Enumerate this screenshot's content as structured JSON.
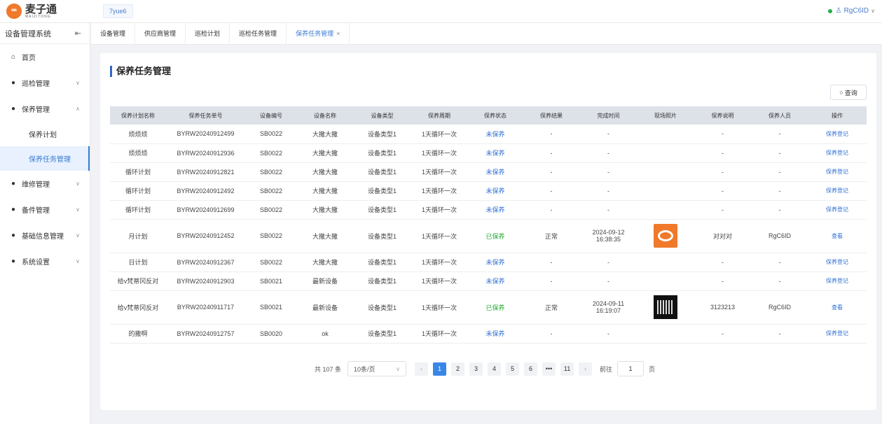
{
  "header": {
    "logo_mark": "ꟹ",
    "logo_cn": "麦子通",
    "logo_en": "MAIZITONG",
    "project": "7yue6",
    "user_name": "RgC6ID",
    "online_color": "#22b14c"
  },
  "sidebar": {
    "system_title": "设备管理系统",
    "collapse_icon": "collapse-left-icon",
    "items": [
      {
        "label": "首页",
        "icon": "home-icon"
      },
      {
        "label": "巡检管理",
        "icon": "person-icon"
      },
      {
        "label": "保养管理",
        "icon": "person-icon",
        "expanded": true
      },
      {
        "label": "保养计划"
      },
      {
        "label": "保养任务管理",
        "active": true
      },
      {
        "label": "维修管理",
        "icon": "person-icon"
      },
      {
        "label": "备件管理",
        "icon": "person-icon"
      },
      {
        "label": "基础信息管理",
        "icon": "person-icon"
      },
      {
        "label": "系统设置",
        "icon": "person-icon"
      }
    ]
  },
  "tabs": [
    {
      "label": "设备管理"
    },
    {
      "label": "供应商管理"
    },
    {
      "label": "巡检计划"
    },
    {
      "label": "巡检任务管理"
    },
    {
      "label": "保养任务管理",
      "active": true,
      "close": "×"
    }
  ],
  "main": {
    "title": "保养任务管理",
    "query_label": "查询",
    "accent_color": "#2f67c9"
  },
  "table": {
    "columns": [
      "保养计划名称",
      "保养任务单号",
      "设备编号",
      "设备名称",
      "设备类型",
      "保养周期",
      "保养状态",
      "保养结果",
      "完成时间",
      "现场照片",
      "保养说明",
      "保养人员",
      "操作"
    ],
    "rows": [
      {
        "plan": "烦烦烦",
        "task_no": "BYRW20240912499",
        "dev_no": "SB0022",
        "dev_name": "大撒大撒",
        "dev_type": "设备类型1",
        "cycle": "1天循环一次",
        "status": "未保养",
        "result": "-",
        "finish_time": "-",
        "photo": "",
        "desc": "-",
        "staff": "-",
        "op": "保养登记"
      },
      {
        "plan": "烦烦烦",
        "task_no": "BYRW20240912936",
        "dev_no": "SB0022",
        "dev_name": "大撒大撒",
        "dev_type": "设备类型1",
        "cycle": "1天循环一次",
        "status": "未保养",
        "result": "-",
        "finish_time": "-",
        "photo": "",
        "desc": "-",
        "staff": "-",
        "op": "保养登记"
      },
      {
        "plan": "循环计划",
        "task_no": "BYRW20240912821",
        "dev_no": "SB0022",
        "dev_name": "大撒大撒",
        "dev_type": "设备类型1",
        "cycle": "1天循环一次",
        "status": "未保养",
        "result": "-",
        "finish_time": "-",
        "photo": "",
        "desc": "-",
        "staff": "-",
        "op": "保养登记"
      },
      {
        "plan": "循环计划",
        "task_no": "BYRW20240912492",
        "dev_no": "SB0022",
        "dev_name": "大撒大撒",
        "dev_type": "设备类型1",
        "cycle": "1天循环一次",
        "status": "未保养",
        "result": "-",
        "finish_time": "-",
        "photo": "",
        "desc": "-",
        "staff": "-",
        "op": "保养登记"
      },
      {
        "plan": "循环计划",
        "task_no": "BYRW20240912699",
        "dev_no": "SB0022",
        "dev_name": "大撒大撒",
        "dev_type": "设备类型1",
        "cycle": "1天循环一次",
        "status": "未保养",
        "result": "-",
        "finish_time": "-",
        "photo": "",
        "desc": "-",
        "staff": "-",
        "op": "保养登记"
      },
      {
        "plan": "月计划",
        "task_no": "BYRW20240912452",
        "dev_no": "SB0022",
        "dev_name": "大撒大撒",
        "dev_type": "设备类型1",
        "cycle": "1天循环一次",
        "status": "已保养",
        "result": "正常",
        "finish_time": "2024-09-12 16:38:35",
        "photo": "logo",
        "desc": "对对对",
        "staff": "RgC6ID",
        "op": "查看"
      },
      {
        "plan": "日计划",
        "task_no": "BYRW20240912367",
        "dev_no": "SB0022",
        "dev_name": "大撒大撒",
        "dev_type": "设备类型1",
        "cycle": "1天循环一次",
        "status": "未保养",
        "result": "-",
        "finish_time": "-",
        "photo": "",
        "desc": "-",
        "staff": "-",
        "op": "保养登记"
      },
      {
        "plan": "给v梵蒂冈反对",
        "task_no": "BYRW20240912903",
        "dev_no": "SB0021",
        "dev_name": "最新设备",
        "dev_type": "设备类型1",
        "cycle": "1天循环一次",
        "status": "未保养",
        "result": "-",
        "finish_time": "-",
        "photo": "",
        "desc": "-",
        "staff": "-",
        "op": "保养登记"
      },
      {
        "plan": "给v梵蒂冈反对",
        "task_no": "BYRW20240911717",
        "dev_no": "SB0021",
        "dev_name": "最新设备",
        "dev_type": "设备类型1",
        "cycle": "1天循环一次",
        "status": "已保养",
        "result": "正常",
        "finish_time": "2024-09-11 16:19:07",
        "photo": "qr",
        "desc": "3123213",
        "staff": "RgC6ID",
        "op": "查看"
      },
      {
        "plan": "的撒啊",
        "task_no": "BYRW20240912757",
        "dev_no": "SB0020",
        "dev_name": "ok",
        "dev_type": "设备类型1",
        "cycle": "1天循环一次",
        "status": "未保养",
        "result": "-",
        "finish_time": "-",
        "photo": "",
        "desc": "-",
        "staff": "-",
        "op": "保养登记"
      }
    ],
    "status_colors": {
      "未保养": "#2f6fd3",
      "已保养": "#22aa33"
    }
  },
  "pagination": {
    "total": "共 107 条",
    "page_size": "10条/页",
    "pages": [
      "1",
      "2",
      "3",
      "4",
      "5",
      "6",
      "•••",
      "11"
    ],
    "current": "1",
    "goto_label": "前往",
    "goto_value": "1",
    "page_unit": "页"
  }
}
